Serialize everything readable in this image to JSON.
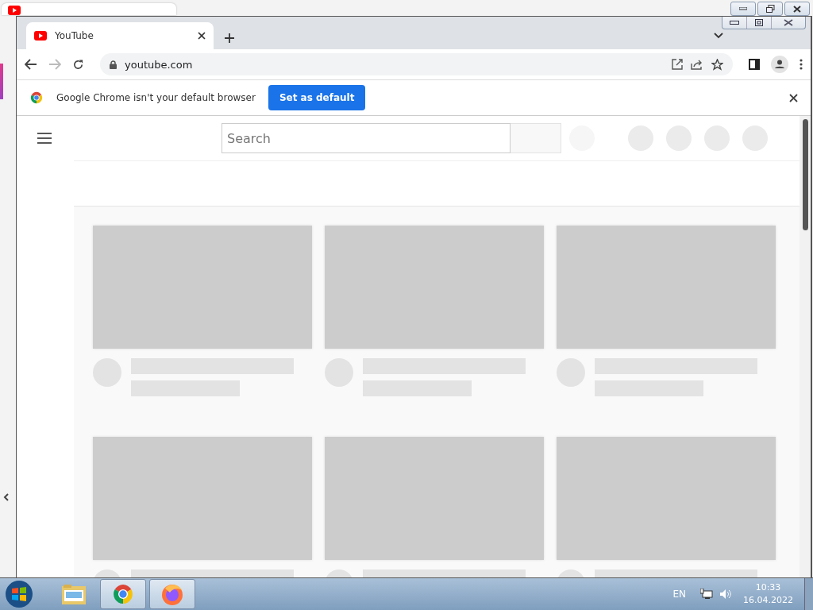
{
  "browser": {
    "tab": {
      "title": "YouTube",
      "selected": true
    },
    "address": "youtube.com",
    "infobar": {
      "message": "Google Chrome isn't your default browser",
      "button": "Set as default"
    }
  },
  "page": {
    "search": {
      "placeholder": "Search"
    }
  },
  "taskbar": {
    "apps": [
      {
        "kind": "explorer",
        "running": false
      },
      {
        "kind": "chrome",
        "running": true
      },
      {
        "kind": "firefox",
        "running": true
      }
    ],
    "language": "EN",
    "time": "10:33",
    "date": "16.04.2022"
  }
}
